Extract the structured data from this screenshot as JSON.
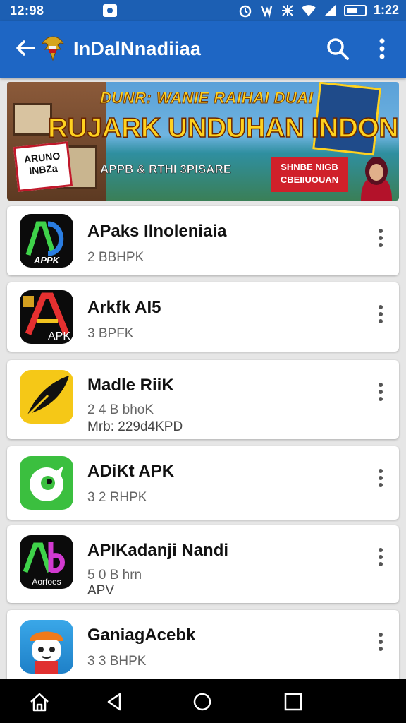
{
  "status_bar": {
    "time": "12:98",
    "clock": "1:22"
  },
  "app_bar": {
    "title": "InDalNnadiiaa"
  },
  "banner": {
    "headline1": "DUNR: WANIE RAIHAI DUAI",
    "headline2": "RUJARK UNDUHAN INDONESIA",
    "subtitle": "APPB & RTHI 3PISARE",
    "sign_text": "ARUNO\nINBZa",
    "red_box": "SHNBE NIGB\nCBEIIUOUAN"
  },
  "apps": [
    {
      "name": "APaks Ilnoleniaia",
      "size": "2 BBHPK",
      "extra": "",
      "icon": "ad-apk-icon",
      "icon_label": "APPK"
    },
    {
      "name": "Arkfk AI5",
      "size": "3 BPFK",
      "extra": "",
      "icon": "a-apk-icon",
      "icon_label": "APK"
    },
    {
      "name": "Madle RiiK",
      "size": "2 4 B bhoK",
      "extra": "Mrb: 229d4KPD",
      "icon": "feather-icon",
      "icon_label": ""
    },
    {
      "name": "ADiKt APK",
      "size": "3 2 RHPK",
      "extra": "",
      "icon": "green-bird-icon",
      "icon_label": ""
    },
    {
      "name": "APIKadanji Nandi",
      "size": "5 0 B hrn",
      "extra": "APV",
      "icon": "ab-apk-icon",
      "icon_label": "Aorfoes"
    },
    {
      "name": "GaniagAcebk",
      "size": "3 3 BHPK",
      "extra": "",
      "icon": "robot-icon",
      "icon_label": ""
    }
  ],
  "colors": {
    "primary": "#1e66c4",
    "status": "#1c5fb3",
    "background": "#e6e6e6"
  }
}
